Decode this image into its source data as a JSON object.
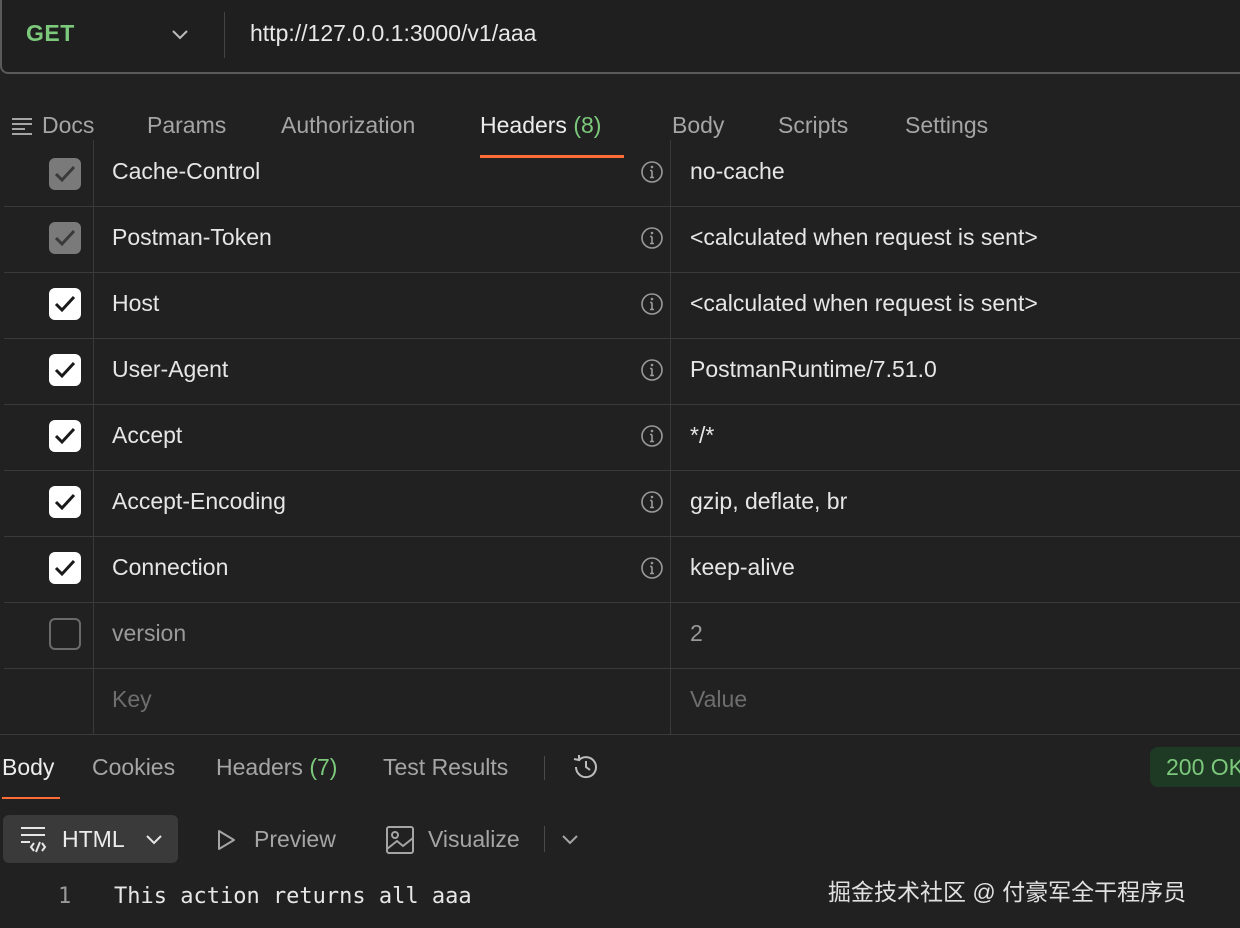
{
  "url_bar": {
    "method": "GET",
    "url": "http://127.0.0.1:3000/v1/aaa"
  },
  "request_tabs": [
    {
      "label": "Docs"
    },
    {
      "label": "Params"
    },
    {
      "label": "Authorization"
    },
    {
      "label": "Headers",
      "count": "(8)",
      "active": true
    },
    {
      "label": "Body"
    },
    {
      "label": "Scripts"
    },
    {
      "label": "Settings"
    }
  ],
  "headers_table": {
    "rows": [
      {
        "key": "Cache-Control",
        "value": "no-cache",
        "checked": "disabled"
      },
      {
        "key": "Postman-Token",
        "value": "<calculated when request is sent>",
        "checked": "disabled"
      },
      {
        "key": "Host",
        "value": "<calculated when request is sent>",
        "checked": "on"
      },
      {
        "key": "User-Agent",
        "value": "PostmanRuntime/7.51.0",
        "checked": "on"
      },
      {
        "key": "Accept",
        "value": "*/*",
        "checked": "on"
      },
      {
        "key": "Accept-Encoding",
        "value": "gzip, deflate, br",
        "checked": "on"
      },
      {
        "key": "Connection",
        "value": "keep-alive",
        "checked": "on"
      },
      {
        "key": "version",
        "value": "2",
        "checked": "off"
      }
    ],
    "new_row": {
      "key_placeholder": "Key",
      "value_placeholder": "Value"
    }
  },
  "response_tabs": [
    {
      "label": "Body",
      "active": true
    },
    {
      "label": "Cookies"
    },
    {
      "label": "Headers",
      "count": "(7)"
    },
    {
      "label": "Test Results"
    }
  ],
  "status": "200 OK",
  "format_toolbar": {
    "format": "HTML",
    "preview": "Preview",
    "visualize": "Visualize"
  },
  "code": {
    "line_number": "1",
    "line_text": "This action returns all aaa"
  },
  "watermark": "掘金技术社区 @ 付豪军全干程序员",
  "colors": {
    "accent": "#ff6c37",
    "green": "#7cc97c",
    "background": "#212121"
  }
}
